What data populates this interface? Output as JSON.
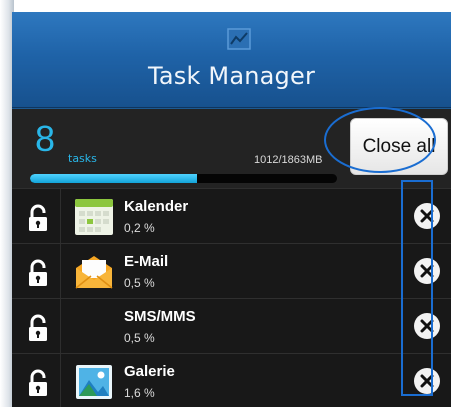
{
  "header": {
    "title": "Task Manager",
    "icon": "chart-icon"
  },
  "stats": {
    "task_count": "8",
    "task_label": "tasks",
    "memory_text": "1012/1863MB",
    "memory_fraction": 0.543,
    "close_all_label": "Close all"
  },
  "colors": {
    "accent": "#29b6e8",
    "header": "#1f63a8",
    "highlight": "#1a6dd1"
  },
  "tasks": [
    {
      "name": "Kalender",
      "memory": "0,2 %",
      "icon": "calendar-icon"
    },
    {
      "name": "E-Mail",
      "memory": "0,5 %",
      "icon": "email-icon"
    },
    {
      "name": "SMS/MMS",
      "memory": "0,5 %",
      "icon": ""
    },
    {
      "name": "Galerie",
      "memory": "1,6 %",
      "icon": "gallery-icon"
    }
  ]
}
